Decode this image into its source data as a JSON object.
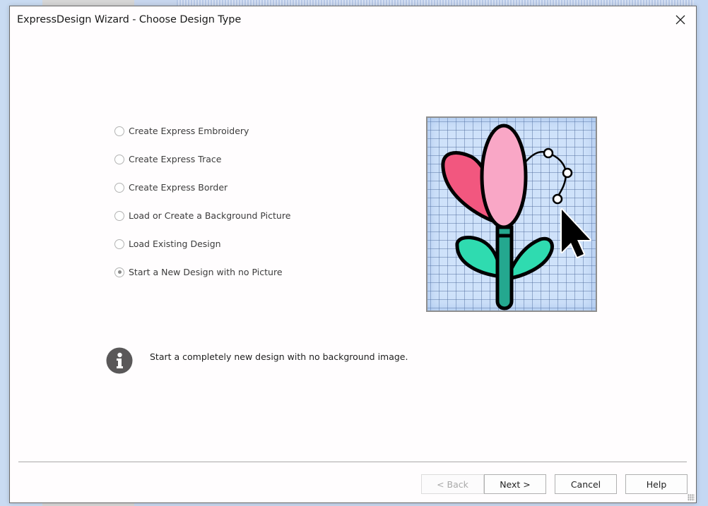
{
  "dialog": {
    "title": "ExpressDesign Wizard - Choose Design Type",
    "close_icon": "close-icon"
  },
  "options": [
    {
      "label": "Create Express Embroidery",
      "checked": false
    },
    {
      "label": "Create Express Trace",
      "checked": false
    },
    {
      "label": "Create Express Border",
      "checked": false
    },
    {
      "label": "Load or Create a Background Picture",
      "checked": false
    },
    {
      "label": "Load Existing Design",
      "checked": false
    },
    {
      "label": "Start a New Design with no Picture",
      "checked": true
    }
  ],
  "preview": {
    "icon": "flower-design-illustration",
    "colors": {
      "petal_left": "#f2577f",
      "petal_right": "#f9a7c6",
      "leaves": "#2fdbb0",
      "stem": "#24a88f",
      "grid_bg": "#cfe2fa"
    }
  },
  "info": {
    "icon": "info-icon",
    "text": "Start a completely new design with no background image."
  },
  "buttons": {
    "back": {
      "label": "< Back",
      "enabled": false
    },
    "next": {
      "label": "Next >",
      "enabled": true
    },
    "cancel": {
      "label": "Cancel",
      "enabled": true
    },
    "help": {
      "label": "Help",
      "enabled": true
    }
  }
}
